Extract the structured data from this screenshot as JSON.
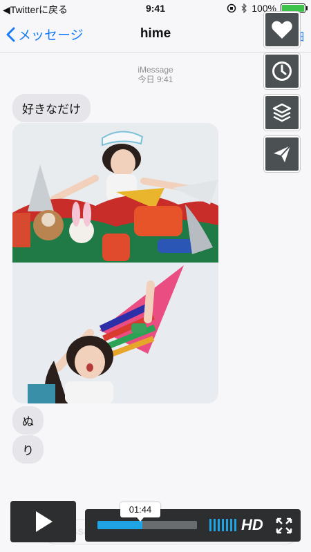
{
  "status_bar": {
    "back_app": "◀Twitterに戻る",
    "time": "9:41",
    "battery_text": "100%",
    "battery_level": 1.0
  },
  "nav": {
    "back_label": "メッセージ",
    "title": "hime",
    "detail_label": "詳細"
  },
  "conversation": {
    "service": "iMessage",
    "timestamp": "今日 9:41",
    "messages": [
      {
        "type": "text",
        "text": "好きなだけ"
      },
      {
        "type": "image",
        "description_icon": "photo-image"
      },
      {
        "type": "image",
        "description_icon": "photo-image"
      },
      {
        "type": "text",
        "text": "ぬ"
      },
      {
        "type": "text",
        "text": "り"
      }
    ]
  },
  "side_actions": [
    {
      "icon": "heart-icon"
    },
    {
      "icon": "clock-icon"
    },
    {
      "icon": "layers-icon"
    },
    {
      "icon": "send-icon"
    }
  ],
  "player": {
    "time_tooltip": "01:44",
    "progress": 0.45,
    "hd_label": "HD",
    "accent": "#1ea3e5"
  },
  "compose": {
    "placeholder": "iMessage"
  }
}
